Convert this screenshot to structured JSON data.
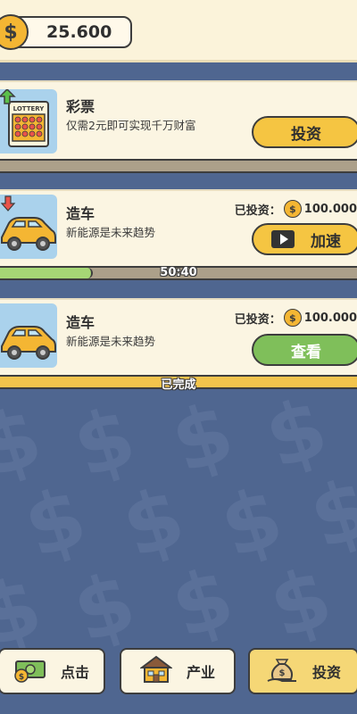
{
  "balance": "25.600",
  "cards": [
    {
      "title": "彩票",
      "desc": "仅需2元即可实现千万财富",
      "thumb_label": "LOTTERY",
      "button": "投资"
    },
    {
      "title": "造车",
      "desc": "新能源是未来趋势",
      "invested_label": "已投资：",
      "invested_amount": "100.000",
      "button": "加速",
      "timer": "50:40",
      "progress": 0.26
    },
    {
      "title": "造车",
      "desc": "新能源是未来趋势",
      "invested_label": "已投资：",
      "invested_amount": "100.000",
      "button": "查看",
      "status": "已完成",
      "progress": 1.0
    }
  ],
  "nav": [
    {
      "label": "点击",
      "icon": "cash-icon"
    },
    {
      "label": "产业",
      "icon": "house-icon"
    },
    {
      "label": "投资",
      "icon": "money-bag-icon"
    }
  ],
  "colors": {
    "background": "#4f6690",
    "card": "#fbf5e2",
    "yellow_button": "#f5c542",
    "green_button": "#7fbf5a",
    "progress_green": "#a6d775",
    "coin": "#f4b633"
  }
}
